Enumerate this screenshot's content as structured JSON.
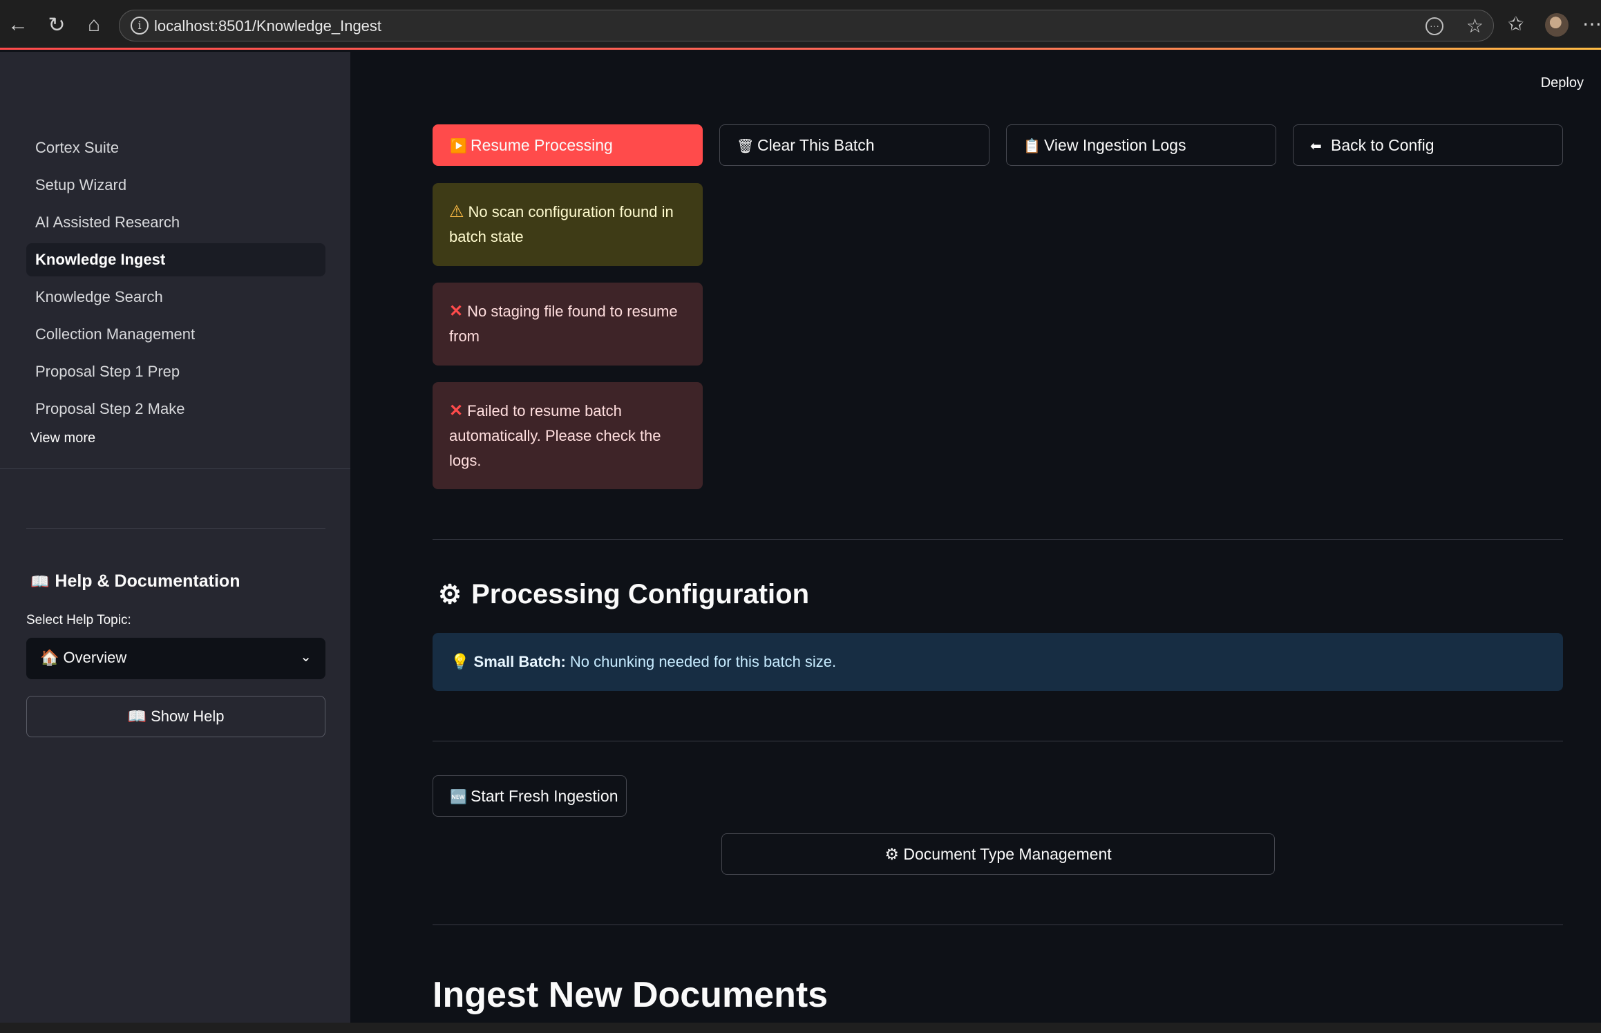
{
  "browser": {
    "url": "localhost:8501/Knowledge_Ingest",
    "back_icon": "arrow-left-icon",
    "reload_icon": "reload-icon",
    "home_icon": "home-icon"
  },
  "sidebar": {
    "items": [
      {
        "label": "Cortex Suite"
      },
      {
        "label": "Setup Wizard"
      },
      {
        "label": "AI Assisted Research"
      },
      {
        "label": "Knowledge Ingest"
      },
      {
        "label": "Knowledge Search"
      },
      {
        "label": "Collection Management"
      },
      {
        "label": "Proposal Step 1 Prep"
      },
      {
        "label": "Proposal Step 2 Make"
      }
    ],
    "active_index": 3,
    "view_more": "View more",
    "help": {
      "title": "Help & Documentation",
      "select_label": "Select Help Topic:",
      "selected_topic": "Overview",
      "show_help_label": "Show Help"
    }
  },
  "header": {
    "deploy_label": "Deploy"
  },
  "actions": {
    "resume": "Resume Processing",
    "clear": "Clear This Batch",
    "logs": "View Ingestion Logs",
    "back": "Back to Config"
  },
  "alerts": {
    "warning": "No scan configuration found in batch state",
    "error1": "No staging file found to resume from",
    "error2": "Failed to resume batch automatically. Please check the logs."
  },
  "processing": {
    "title": "Processing Configuration",
    "info_bold": "Small Batch:",
    "info_text": " No chunking needed for this batch size."
  },
  "buttons": {
    "start_fresh": "Start Fresh Ingestion",
    "doc_type": "Document Type Management"
  },
  "ingest": {
    "title": "Ingest New Documents"
  },
  "colors": {
    "primary": "#ff4b4b",
    "background": "#0e1117",
    "sidebar": "#262730",
    "info": "#172d43",
    "warning": "#3e3b16",
    "error": "#3e2428"
  }
}
